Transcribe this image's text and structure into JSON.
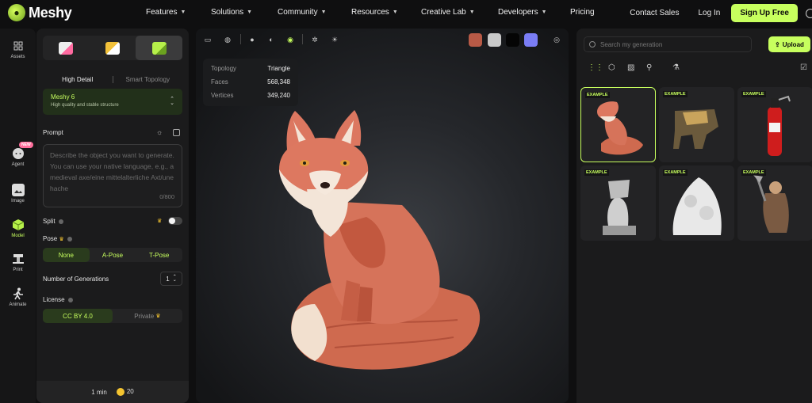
{
  "brand": {
    "name": "Meshy",
    "accent": "#c7ff5e"
  },
  "nav": {
    "items": [
      {
        "label": "Features",
        "dropdown": true
      },
      {
        "label": "Solutions",
        "dropdown": true
      },
      {
        "label": "Community",
        "dropdown": true
      },
      {
        "label": "Resources",
        "dropdown": true
      },
      {
        "label": "Creative Lab",
        "dropdown": true
      },
      {
        "label": "Developers",
        "dropdown": true
      },
      {
        "label": "Pricing",
        "dropdown": false
      }
    ],
    "contact": "Contact Sales",
    "login": "Log In",
    "signup": "Sign Up Free"
  },
  "rail": {
    "items": [
      {
        "label": "Assets",
        "icon": "grid-icon"
      },
      {
        "label": "Agent",
        "icon": "chat-icon",
        "badge": "NEW"
      },
      {
        "label": "Image",
        "icon": "image-icon"
      },
      {
        "label": "Model",
        "icon": "cube-icon",
        "active": true
      },
      {
        "label": "Print",
        "icon": "printer-icon"
      },
      {
        "label": "Animate",
        "icon": "running-icon"
      }
    ]
  },
  "panel": {
    "detail_tabs": [
      "High Detail",
      "Smart Topology"
    ],
    "model": {
      "name": "Meshy 6",
      "desc": "High quality and stable structure"
    },
    "prompt_label": "Prompt",
    "prompt_placeholder": "Describe the object you want to generate. You can use your native language, e.g., a medieval axe/eine mittelalterliche Axt/une hache",
    "prompt_count": "0/800",
    "split_label": "Split",
    "pose_label": "Pose",
    "pose_options": [
      "None",
      "A-Pose",
      "T-Pose"
    ],
    "generations_label": "Number of Generations",
    "generations_value": "1",
    "license_label": "License",
    "license_options": [
      "CC BY 4.0",
      "Private"
    ],
    "footer_time": "1 min",
    "footer_credits": "20"
  },
  "viewport": {
    "stats": [
      {
        "k": "Topology",
        "v": "Triangle"
      },
      {
        "k": "Faces",
        "v": "568,348"
      },
      {
        "k": "Vertices",
        "v": "349,240"
      }
    ],
    "swatches": [
      "#b85a46",
      "#c9c9c9",
      "#050505",
      "#7a7df5"
    ]
  },
  "gallery": {
    "search_placeholder": "Search my generation",
    "upload_label": "Upload",
    "badge": "EXAMPLE",
    "cards": [
      {
        "subject": "fox"
      },
      {
        "subject": "robot"
      },
      {
        "subject": "fire-extinguisher"
      },
      {
        "subject": "bust"
      },
      {
        "subject": "sculpture"
      },
      {
        "subject": "warrior"
      }
    ]
  }
}
